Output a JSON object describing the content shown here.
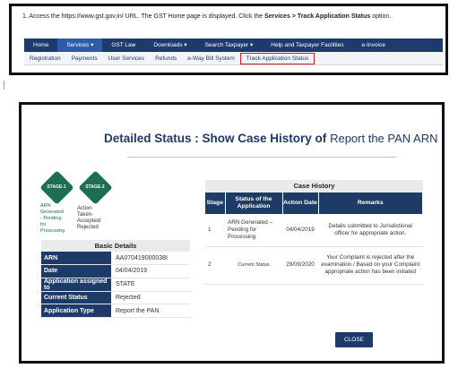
{
  "instruction": {
    "prefix": "1. Access the https://www.gst.gov.in/ URL. The GST Home page is displayed. Click the",
    "bold": "Services > Track Application Status",
    "suffix": "option."
  },
  "nav": {
    "items": [
      "Home",
      "Services ▾",
      "GST Law",
      "Downloads ▾",
      "Search Taxpayer ▾",
      "Help and Taxpayer Facilities",
      "e-Invoice"
    ]
  },
  "subnav": {
    "items": [
      "Registration",
      "Payments",
      "User Services",
      "Refunds",
      "e-Way Bill System",
      "Track Application Status"
    ]
  },
  "status": {
    "title": "Detailed Status : Show Case History of",
    "title_rest": "Report the PAN ARN",
    "stage1": {
      "label": "STAGE-1",
      "caption": [
        "ARN",
        "Generated",
        "- Pending",
        "for",
        "Processing"
      ]
    },
    "stage2": {
      "label": "STAGE-2",
      "caption": [
        "Action",
        "Taken-",
        "Accepted/",
        "Rejected"
      ]
    }
  },
  "basic_details": {
    "title": "Basic Details",
    "rows": [
      {
        "key": "ARN",
        "value": "AA070419000038I"
      },
      {
        "key": "Date",
        "value": "04/04/2019"
      },
      {
        "key": "Application assigned to",
        "value": "STATE"
      },
      {
        "key": "Current Status",
        "value": "Rejected"
      },
      {
        "key": "Application Type",
        "value": "Report the PAN"
      }
    ]
  },
  "case_history": {
    "title": "Case History",
    "headers": [
      "Stage",
      "Status of the Application",
      "Action Date",
      "Remarks"
    ],
    "rows": [
      {
        "stage": "1",
        "status": "ARN Generated – Pending for Processing",
        "date": "04/04/2019",
        "remarks": "Details submitted to Jurisdictional officer for appropriate action."
      },
      {
        "stage": "2",
        "status": "Current Status",
        "date": "29/09/2020",
        "remarks": "Your Complaint is rejected after the examination / Based on your Complaint appropriate action has been initiated"
      }
    ]
  },
  "close_label": "CLOSE",
  "colors": {
    "navy": "#1e3a66",
    "nav_bg": "#1f3b6e",
    "stage_green": "#1e6d55",
    "highlight_red": "#d0202b"
  }
}
